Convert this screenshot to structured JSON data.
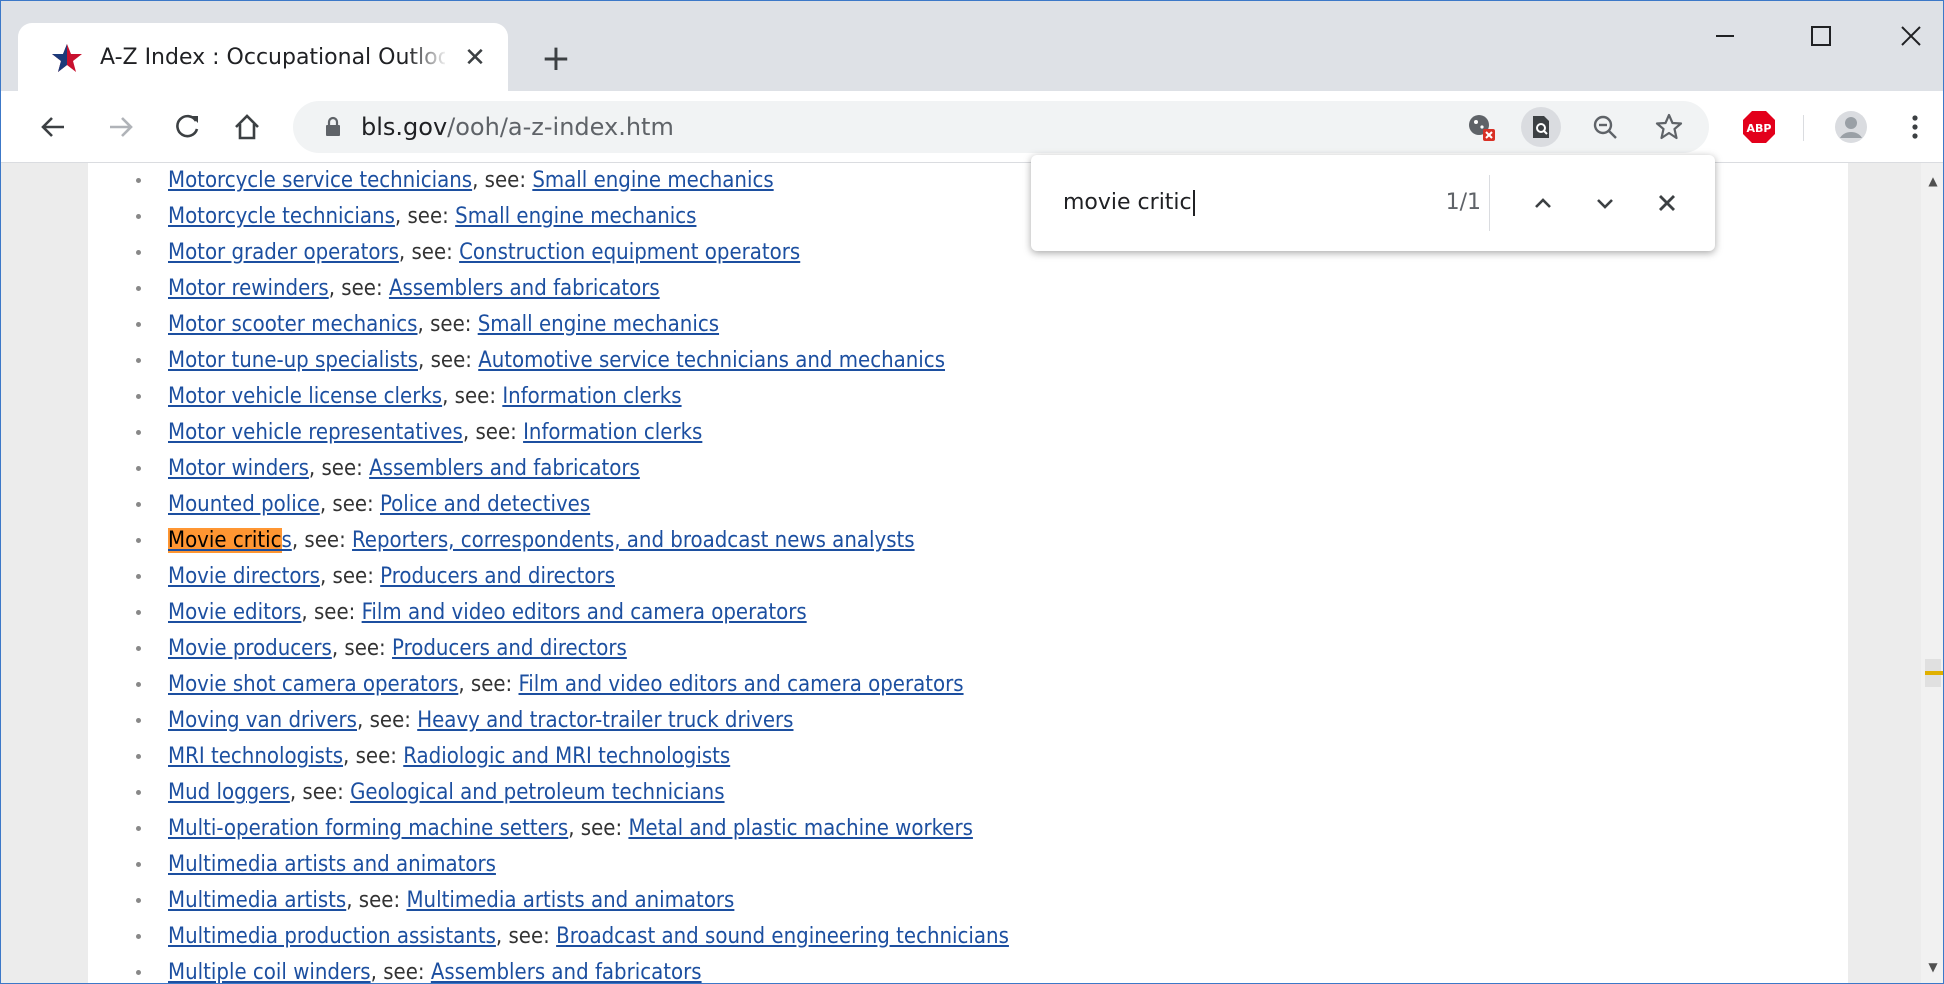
{
  "browser": {
    "tab_title": "A-Z Index : Occupational Outlook Handbook",
    "tab_favicon": "bls-star-icon",
    "new_tab_label": "+",
    "url_host": "bls.gov",
    "url_path": "/ooh/a-z-index.htm",
    "window_controls": [
      "minimize",
      "maximize",
      "close"
    ]
  },
  "find_bar": {
    "query": "movie critic",
    "match_count": "1/1"
  },
  "colors": {
    "link": "#1c4fa0",
    "highlight": "#ff9632",
    "tabstrip": "#dee1e6"
  },
  "list": [
    {
      "link": "Motorcycle service technicians",
      "see": "Small engine mechanics"
    },
    {
      "link": "Motorcycle technicians",
      "see": "Small engine mechanics"
    },
    {
      "link": "Motor grader operators",
      "see": "Construction equipment operators"
    },
    {
      "link": "Motor rewinders",
      "see": "Assemblers and fabricators"
    },
    {
      "link": "Motor scooter mechanics",
      "see": "Small engine mechanics"
    },
    {
      "link": "Motor tune-up specialists",
      "see": "Automotive service technicians and mechanics"
    },
    {
      "link": "Motor vehicle license clerks",
      "see": "Information clerks"
    },
    {
      "link": "Motor vehicle representatives",
      "see": "Information clerks"
    },
    {
      "link": "Motor winders",
      "see": "Assemblers and fabricators"
    },
    {
      "link": "Mounted police",
      "see": "Police and detectives"
    },
    {
      "link_highlight": "Movie critic",
      "link": "s",
      "see": "Reporters, correspondents, and broadcast news analysts"
    },
    {
      "link": "Movie directors",
      "see": "Producers and directors"
    },
    {
      "link": "Movie editors",
      "see": "Film and video editors and camera operators"
    },
    {
      "link": "Movie producers",
      "see": "Producers and directors"
    },
    {
      "link": "Movie shot camera operators",
      "see": "Film and video editors and camera operators"
    },
    {
      "link": "Moving van drivers",
      "see": "Heavy and tractor-trailer truck drivers"
    },
    {
      "link": "MRI technologists",
      "see": "Radiologic and MRI technologists"
    },
    {
      "link": "Mud loggers",
      "see": "Geological and petroleum technicians"
    },
    {
      "link": "Multi-operation forming machine setters",
      "see": "Metal and plastic machine workers"
    },
    {
      "link": "Multimedia artists and animators",
      "see": ""
    },
    {
      "link": "Multimedia artists",
      "see": "Multimedia artists and animators"
    },
    {
      "link": "Multimedia production assistants",
      "see": "Broadcast and sound engineering technicians"
    },
    {
      "link": "Multiple coil winders",
      "see": "Assemblers and fabricators"
    }
  ],
  "see_label": ", see: "
}
